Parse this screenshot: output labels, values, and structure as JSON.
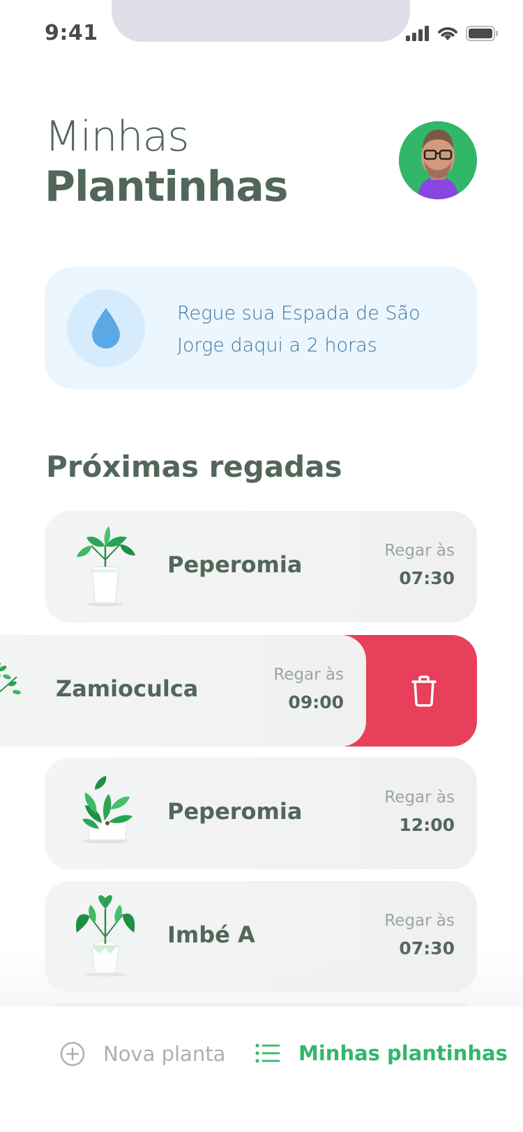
{
  "status_bar": {
    "time": "9:41"
  },
  "header": {
    "greeting": "Minhas",
    "title": "Plantinhas"
  },
  "tip": {
    "text": "Regue sua Espada de São Jorge daqui a 2 horas"
  },
  "section": {
    "title": "Próximas regadas"
  },
  "plants": [
    {
      "name": "Peperomia",
      "water_label": "Regar às",
      "time": "07:30",
      "icon": "plant-peperomia-icon"
    },
    {
      "name": "Zamioculca",
      "water_label": "Regar às",
      "time": "09:00",
      "icon": "plant-zamioculca-icon",
      "swiped": true
    },
    {
      "name": "Peperomia",
      "water_label": "Regar às",
      "time": "12:00",
      "icon": "plant-peperomia-pot-icon"
    },
    {
      "name": "Imbé A",
      "water_label": "Regar às",
      "time": "07:30",
      "icon": "plant-imbe-icon"
    }
  ],
  "tab_bar": {
    "new_plant": "Nova planta",
    "my_plants": "Minhas plantinhas"
  },
  "colors": {
    "green": "#32B768",
    "heading": "#52665A",
    "danger": "#E83F5B",
    "blue_bg": "#EBF6FF",
    "blue_text": "#3D7199"
  }
}
